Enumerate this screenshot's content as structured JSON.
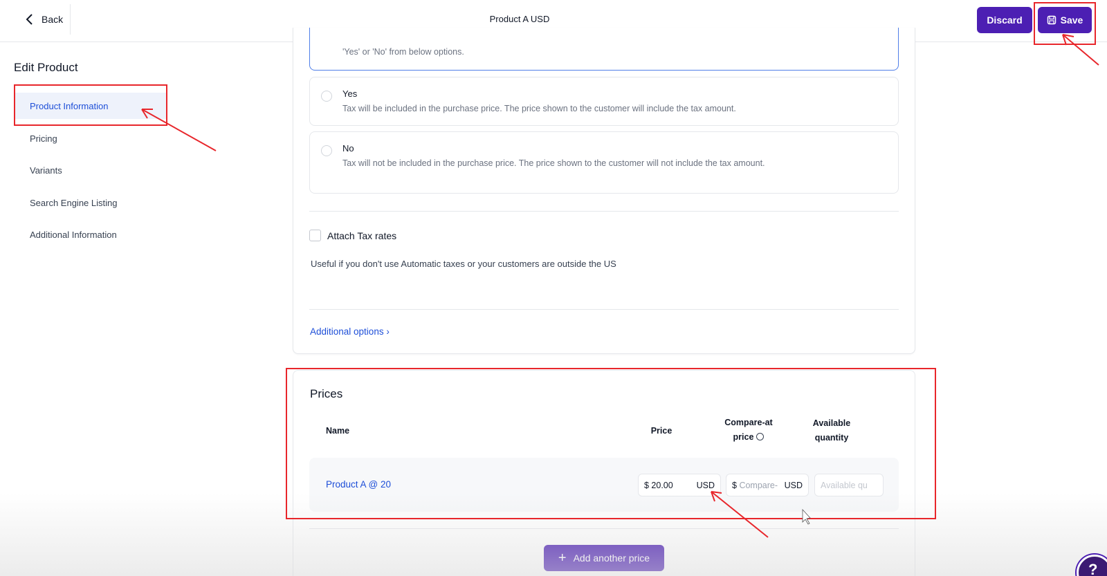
{
  "header": {
    "back_label": "Back",
    "title": "Product A USD",
    "discard_label": "Discard",
    "save_label": "Save"
  },
  "sidebar": {
    "title": "Edit Product",
    "items": [
      {
        "label": "Product Information",
        "active": true
      },
      {
        "label": "Pricing"
      },
      {
        "label": "Variants"
      },
      {
        "label": "Search Engine Listing"
      },
      {
        "label": "Additional Information"
      }
    ]
  },
  "tax": {
    "top_text": "'Yes' or 'No' from below options.",
    "options": [
      {
        "label": "Yes",
        "desc": "Tax will be included in the purchase price. The price shown to the customer will include the tax amount."
      },
      {
        "label": "No",
        "desc": "Tax will not be included in the purchase price. The price shown to the customer will not include the tax amount."
      }
    ],
    "attach_label": "Attach Tax rates",
    "helper": "Useful if you don't use Automatic taxes or your customers are outside the US",
    "additional_options": "Additional options"
  },
  "prices": {
    "title": "Prices",
    "columns": {
      "name": "Name",
      "price": "Price",
      "compare_line1": "Compare-at",
      "compare_line2": "price",
      "qty_line1": "Available",
      "qty_line2": "quantity"
    },
    "rows": [
      {
        "name": "Product A @ 20",
        "price": "$ 20.00",
        "currency": "USD",
        "compare_prefix": "$",
        "compare_placeholder": "Compare-",
        "compare_currency": "USD",
        "qty_placeholder": "Available qu"
      }
    ],
    "add_label": "Add another price"
  },
  "colors": {
    "accent": "#4c1fb3",
    "link": "#1d4ed8",
    "annotation": "#e8262b"
  }
}
